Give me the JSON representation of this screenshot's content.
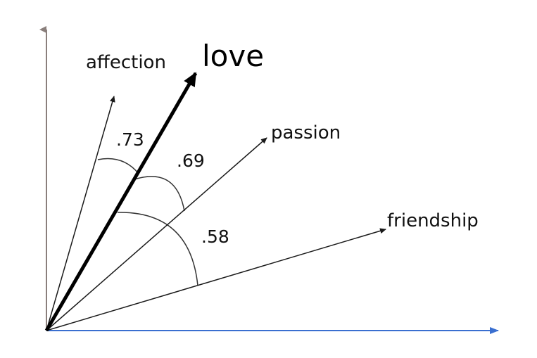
{
  "colors": {
    "background": "#ffffff",
    "y_axis": "#8a7f7c",
    "x_axis": "#3a6fd0",
    "vector": "#1a1a1a",
    "main_vector": "#000000",
    "arc": "#333333",
    "text": "#111111"
  },
  "vectors": [
    {
      "id": "love",
      "label": "love",
      "emphasis": true
    },
    {
      "id": "affection",
      "label": "affection",
      "emphasis": false
    },
    {
      "id": "passion",
      "label": "passion",
      "emphasis": false
    },
    {
      "id": "friendship",
      "label": "friendship",
      "emphasis": false
    }
  ],
  "similarities": [
    {
      "pair": "love-affection",
      "label": ".73"
    },
    {
      "pair": "love-passion",
      "label": ".69"
    },
    {
      "pair": "love-friendship",
      "label": ".58"
    }
  ]
}
